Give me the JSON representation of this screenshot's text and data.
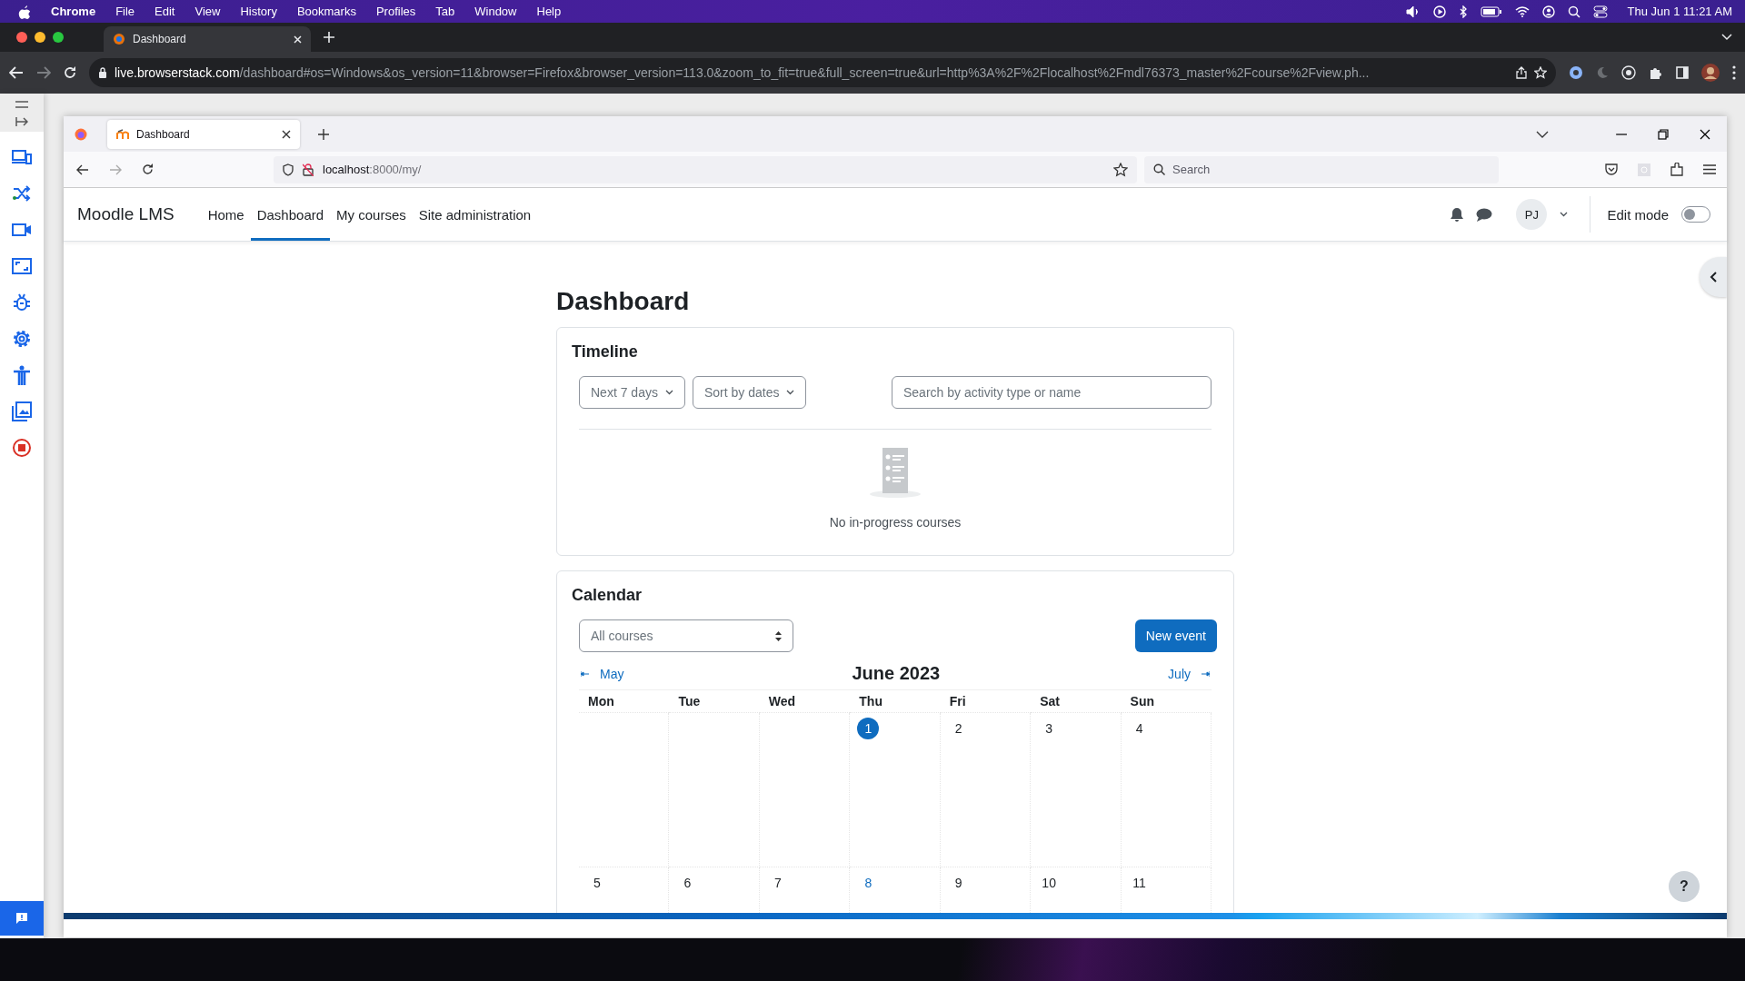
{
  "menubar": {
    "app": "Chrome",
    "items": [
      "File",
      "Edit",
      "View",
      "History",
      "Bookmarks",
      "Profiles",
      "Tab",
      "Window",
      "Help"
    ],
    "clock": "Thu Jun 1  11:21 AM"
  },
  "chrome": {
    "tab": {
      "title": "Dashboard"
    },
    "url_host": "live.browserstack.com",
    "url_rest": "/dashboard#os=Windows&os_version=11&browser=Firefox&browser_version=113.0&zoom_to_fit=true&full_screen=true&url=http%3A%2F%2Flocalhost%2Fmdl76373_master%2Fcourse%2Fview.ph..."
  },
  "firefox": {
    "tab": {
      "title": "Dashboard"
    },
    "url_host": "localhost",
    "url_rest": ":8000/my/",
    "search_placeholder": "Search"
  },
  "moodle": {
    "brand": "Moodle LMS",
    "nav": [
      {
        "label": "Home",
        "selected": false
      },
      {
        "label": "Dashboard",
        "selected": true
      },
      {
        "label": "My courses",
        "selected": false
      },
      {
        "label": "Site administration",
        "selected": false
      }
    ],
    "avatar": "PJ",
    "edit_mode": {
      "label": "Edit mode",
      "on": false
    },
    "title": "Dashboard",
    "timeline": {
      "title": "Timeline",
      "filters": [
        "Next 7 days",
        "Sort by dates"
      ],
      "search_placeholder": "Search by activity type or name",
      "empty": "No in-progress courses"
    },
    "calendar": {
      "title": "Calendar",
      "course_select": "All courses",
      "new_event": "New event",
      "prev": "May",
      "month": "June 2023",
      "next": "July",
      "weekdays": [
        "Mon",
        "Tue",
        "Wed",
        "Thu",
        "Fri",
        "Sat",
        "Sun"
      ],
      "weeks": [
        [
          {
            "kind": "blank"
          },
          {
            "kind": "blank"
          },
          {
            "kind": "blank"
          },
          {
            "kind": "day",
            "day": "1",
            "today": true,
            "has_event": false
          },
          {
            "kind": "day",
            "day": "2",
            "today": false,
            "has_event": false
          },
          {
            "kind": "day",
            "day": "3",
            "today": false,
            "has_event": false
          },
          {
            "kind": "day",
            "day": "4",
            "today": false,
            "has_event": false
          }
        ],
        [
          {
            "kind": "day",
            "day": "5",
            "today": false,
            "has_event": false
          },
          {
            "kind": "day",
            "day": "6",
            "today": false,
            "has_event": false
          },
          {
            "kind": "day",
            "day": "7",
            "today": false,
            "has_event": false
          },
          {
            "kind": "day",
            "day": "8",
            "today": false,
            "has_event": true
          },
          {
            "kind": "day",
            "day": "9",
            "today": false,
            "has_event": false
          },
          {
            "kind": "day",
            "day": "10",
            "today": false,
            "has_event": false
          },
          {
            "kind": "day",
            "day": "11",
            "today": false,
            "has_event": false
          }
        ]
      ]
    },
    "help": "?"
  }
}
